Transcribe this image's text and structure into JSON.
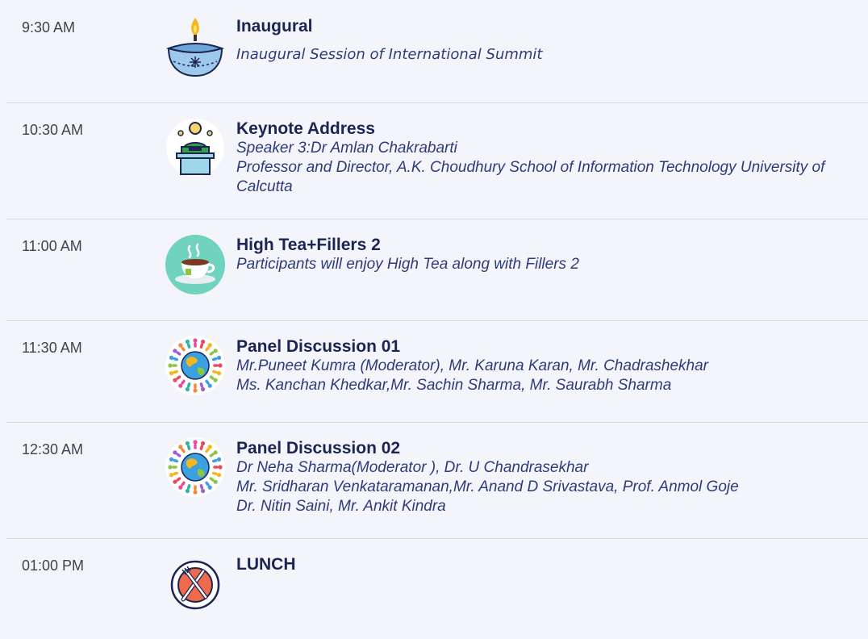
{
  "sessions": [
    {
      "time": "9:30 AM",
      "icon": "diya-lamp-icon",
      "title": "Inaugural",
      "lines": [
        "Inaugural Session of International Summit"
      ]
    },
    {
      "time": "10:30 AM",
      "icon": "speaker-podium-icon",
      "title": "Keynote Address",
      "lines": [
        "Speaker 3:Dr Amlan Chakrabarti",
        "Professor and Director, A.K. Choudhury School of Information Technology University of Calcutta"
      ]
    },
    {
      "time": "11:00 AM",
      "icon": "tea-cup-icon",
      "title": "High Tea+Fillers 2",
      "lines": [
        "Participants will enjoy High Tea along with Fillers 2"
      ]
    },
    {
      "time": "11:30 AM",
      "icon": "globe-people-icon",
      "title": "Panel Discussion 01",
      "lines": [
        "Mr.Puneet Kumra (Moderator), Mr. Karuna Karan, Mr. Chadrashekhar",
        "Ms. Kanchan Khedkar,Mr. Sachin Sharma, Mr. Saurabh Sharma"
      ]
    },
    {
      "time": "12:30 AM",
      "icon": "globe-people-icon",
      "title": "Panel Discussion 02",
      "lines": [
        "Dr Neha Sharma(Moderator ), Dr. U Chandrasekhar",
        "Mr. Sridharan Venkataramanan,Mr. Anand D Srivastava, Prof. Anmol Goje",
        "Dr. Nitin Saini, Mr. Ankit Kindra"
      ]
    },
    {
      "time": "01:00 PM",
      "icon": "plate-cutlery-icon",
      "title": "LUNCH",
      "lines": []
    }
  ],
  "colors": {
    "background": "#f4f5fb",
    "title": "#1b2452",
    "detail": "#2f3a7a",
    "time": "#3e4352",
    "divider": "#d7dbe8"
  }
}
